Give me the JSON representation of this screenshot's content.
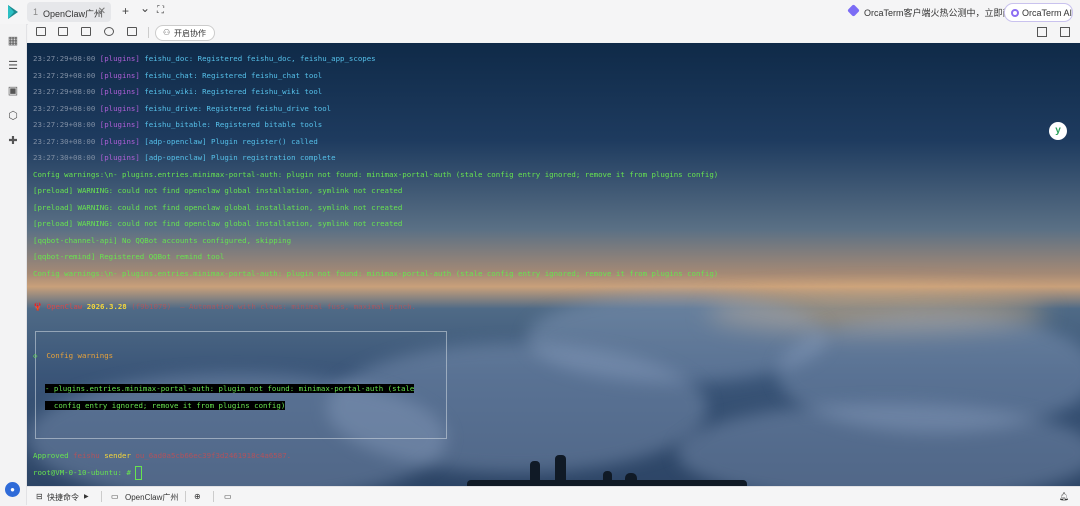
{
  "titlebar": {
    "tab_number": "1",
    "tab_label": "OpenClaw广州",
    "tab_close": "✕",
    "new_tab": "+",
    "tab_menu": "⌄",
    "fullscreen": "⛶",
    "promo_text": "OrcaTerm客户端火热公测中，立即前往",
    "ai_button": "OrcaTerm AI"
  },
  "toolbar": {
    "collab_label": "开启协作"
  },
  "sidebar": {
    "icons": [
      "grid-icon",
      "list-icon",
      "terminal-icon",
      "box-icon",
      "puzzle-icon"
    ]
  },
  "terminal": {
    "lines": [
      {
        "ts": "23:27:29+08:00",
        "tag": "[plugins]",
        "msg": "feishu_doc: Registered feishu_doc, feishu_app_scopes"
      },
      {
        "ts": "23:27:29+08:00",
        "tag": "[plugins]",
        "msg": "feishu_chat: Registered feishu_chat tool"
      },
      {
        "ts": "23:27:29+08:00",
        "tag": "[plugins]",
        "msg": "feishu_wiki: Registered feishu_wiki tool"
      },
      {
        "ts": "23:27:29+08:00",
        "tag": "[plugins]",
        "msg": "feishu_drive: Registered feishu_drive tool"
      },
      {
        "ts": "23:27:29+08:00",
        "tag": "[plugins]",
        "msg": "feishu_bitable: Registered bitable tools"
      },
      {
        "ts": "23:27:30+08:00",
        "tag": "[plugins]",
        "msg": "[adp-openclaw] Plugin register() called"
      },
      {
        "ts": "23:27:30+08:00",
        "tag": "[plugins]",
        "msg": "[adp-openclaw] Plugin registration complete"
      }
    ],
    "plain_lines": [
      "Config warnings:\\n- plugins.entries.minimax-portal-auth: plugin not found: minimax-portal-auth (stale config entry ignored; remove it from plugins config)",
      "[preload] WARNING: could not find openclaw global installation, symlink not created",
      "[preload] WARNING: could not find openclaw global installation, symlink not created",
      "[preload] WARNING: could not find openclaw global installation, symlink not created",
      "[qqbot-channel-api] No QQBot accounts configured, skipping",
      "[qqbot-remind] Registered QQBot remind tool",
      "Config warnings:\\n- plugins.entries.minimax-portal-auth: plugin not found: minimax-portal-auth (stale config entry ignored; remove it from plugins config)"
    ],
    "banner_name": "🦞 OpenClaw",
    "banner_version": "2026.3.28",
    "banner_rest": "(f9b1079)  — Automation with claws: minimal fuss, maximal pinch.",
    "warn_title": "Config warnings",
    "warn_line1": "- plugins.entries.minimax-portal-auth: plugin not found: minimax-portal-auth (stale",
    "warn_line2": "  config entry ignored; remove it from plugins config)",
    "approved_prefix": "Approved",
    "approved_channel": "feishu",
    "approved_sender_label": "sender",
    "approved_sender_id": "ou_6ad0a5cb66ec39f3d2461918c4a6587.",
    "prompt": "root@VM-0-10-ubuntu:",
    "prompt_symbol": "#"
  },
  "statusbar": {
    "quick_commands": "快捷命令",
    "session": "OpenClaw广州"
  },
  "colors": {
    "green": "#67e44f",
    "purple": "#b05fd8",
    "cyan": "#56c1ea",
    "yellow": "#f5d63a"
  }
}
